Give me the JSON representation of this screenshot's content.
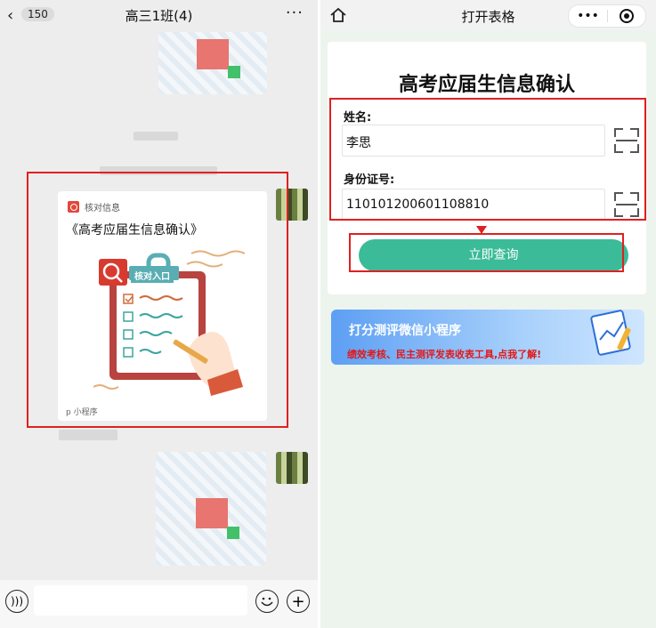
{
  "left": {
    "header": {
      "back_icon": "chevron-left-icon",
      "unread_count": "150",
      "chat_title": "高三1班(4)",
      "more_icon": "more-dots-icon"
    },
    "card": {
      "source_label": "核对信息",
      "title": "《高考应届生信息确认》",
      "illustration_badge": "核对入口",
      "footer_label": "小程序"
    }
  },
  "right": {
    "header": {
      "title": "打开表格",
      "capsule_more": "•••"
    },
    "form": {
      "title": "高考应届生信息确认",
      "name_label": "姓名:",
      "name_value": "李思",
      "id_label": "身份证号:",
      "id_value": "110101200601108810",
      "submit_label": "立即查询"
    },
    "banner": {
      "title": "打分测评微信小程序",
      "subtitle": "绩效考核、民主测评发表收表工具,点我了解!"
    }
  },
  "colors": {
    "accent_button": "#3bbb98",
    "highlight_border": "#e02020",
    "banner_text_red": "#e21818"
  }
}
